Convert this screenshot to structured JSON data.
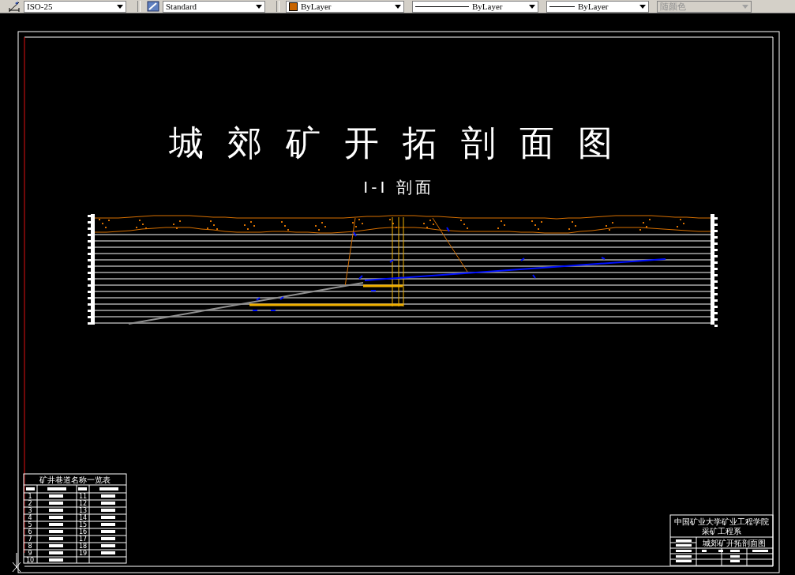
{
  "toolbar": [
    {
      "kind": "dimstyle",
      "value": "ISO-25",
      "disabled": false
    },
    {
      "kind": "textstyle",
      "value": "Standard",
      "disabled": false
    },
    {
      "kind": "color",
      "value": "ByLayer",
      "color": "#c86400",
      "disabled": false
    },
    {
      "kind": "linetype",
      "value": "ByLayer",
      "disabled": false
    },
    {
      "kind": "lineweight",
      "value": "ByLayer",
      "disabled": false
    },
    {
      "kind": "plotstyle",
      "value": "随颜色",
      "disabled": true
    }
  ],
  "drawing": {
    "title": "城郊矿开拓剖面图",
    "subtitle": "I-I 剖面",
    "legend_table": {
      "title": "矿井巷道名称一览表",
      "left_numbers": [
        "1",
        "2",
        "3",
        "4",
        "5",
        "6",
        "7",
        "8",
        "9",
        "10"
      ],
      "right_numbers": [
        "11",
        "12",
        "13",
        "14",
        "15",
        "16",
        "17",
        "18",
        "19"
      ]
    },
    "title_block": {
      "school": "中国矿业大学矿业工程学院",
      "department": "采矿工程系",
      "drawing_name": "城郊矿开拓剖面图"
    }
  }
}
